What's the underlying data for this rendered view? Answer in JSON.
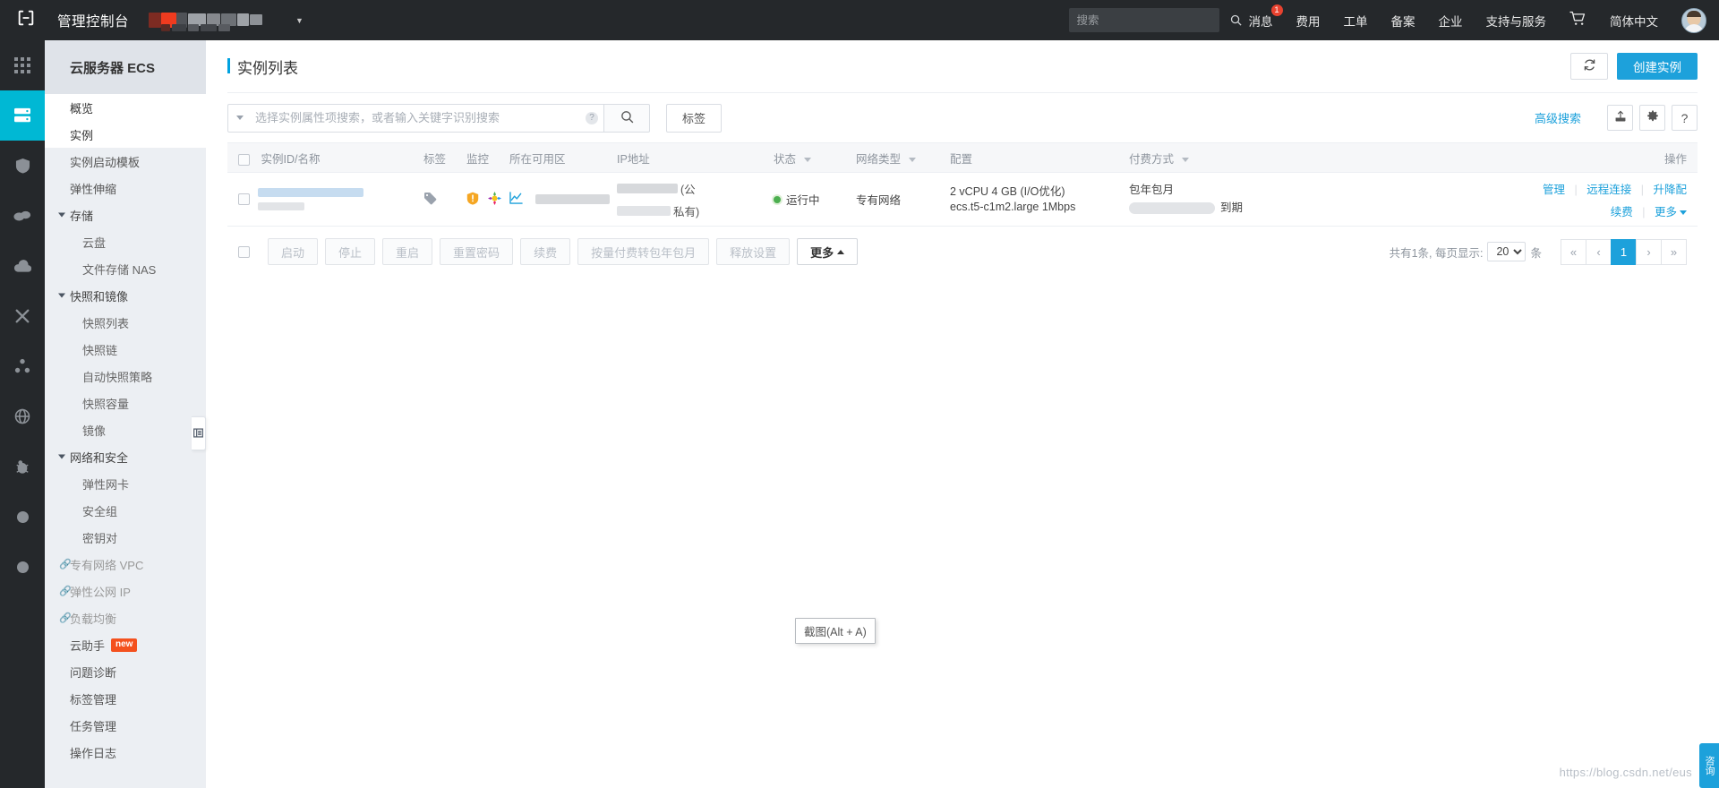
{
  "header": {
    "logo_icon": "cloud-console-logo-icon",
    "console_title": "管理控制台",
    "account_caret_icon": "chevron-down-icon",
    "search_placeholder": "搜索",
    "search_value": "",
    "search_icon": "search-icon",
    "nav_links": [
      {
        "label": "消息",
        "badge": "1"
      },
      {
        "label": "费用",
        "badge": ""
      },
      {
        "label": "工单",
        "badge": ""
      },
      {
        "label": "备案",
        "badge": ""
      },
      {
        "label": "企业",
        "badge": ""
      },
      {
        "label": "支持与服务",
        "badge": ""
      }
    ],
    "cart_icon": "shopping-cart-icon",
    "language": "简体中文",
    "avatar_icon": "user-avatar"
  },
  "rail": {
    "items": [
      {
        "icon": "app-grid-icon",
        "active": false
      },
      {
        "icon": "server-stack-icon",
        "active": true
      },
      {
        "icon": "shield-icon",
        "active": false
      },
      {
        "icon": "cloud-database-icon",
        "active": false
      },
      {
        "icon": "cloud-icon",
        "active": false
      },
      {
        "icon": "network-nodes-icon",
        "active": false
      },
      {
        "icon": "share-nodes-icon",
        "active": false
      },
      {
        "icon": "globe-icon",
        "active": false
      },
      {
        "icon": "bug-icon",
        "active": false
      },
      {
        "icon": "circle-icon",
        "active": false
      },
      {
        "icon": "circle-icon",
        "active": false
      }
    ]
  },
  "sidebar": {
    "product_title": "云服务器 ECS",
    "collapse_icon": "collapse-panel-icon",
    "items": [
      {
        "label": "概览",
        "type": "item",
        "active": false
      },
      {
        "label": "实例",
        "type": "item",
        "active": true
      },
      {
        "label": "实例启动模板",
        "type": "item",
        "active": false
      },
      {
        "label": "弹性伸缩",
        "type": "item",
        "active": false
      },
      {
        "label": "存储",
        "type": "group",
        "active": false
      },
      {
        "label": "云盘",
        "type": "sub",
        "active": false
      },
      {
        "label": "文件存储 NAS",
        "type": "sub",
        "active": false
      },
      {
        "label": "快照和镜像",
        "type": "group",
        "active": false
      },
      {
        "label": "快照列表",
        "type": "sub",
        "active": false
      },
      {
        "label": "快照链",
        "type": "sub",
        "active": false
      },
      {
        "label": "自动快照策略",
        "type": "sub",
        "active": false
      },
      {
        "label": "快照容量",
        "type": "sub",
        "active": false
      },
      {
        "label": "镜像",
        "type": "sub",
        "active": false
      },
      {
        "label": "网络和安全",
        "type": "group",
        "active": false
      },
      {
        "label": "弹性网卡",
        "type": "sub",
        "active": false
      },
      {
        "label": "安全组",
        "type": "sub",
        "active": false
      },
      {
        "label": "密钥对",
        "type": "sub",
        "active": false
      },
      {
        "label": "专有网络 VPC",
        "type": "ext",
        "active": false
      },
      {
        "label": "弹性公网 IP",
        "type": "ext",
        "active": false
      },
      {
        "label": "负载均衡",
        "type": "ext",
        "active": false
      },
      {
        "label": "云助手",
        "type": "item",
        "active": false,
        "tag": "new"
      },
      {
        "label": "问题诊断",
        "type": "item",
        "active": false
      },
      {
        "label": "标签管理",
        "type": "item",
        "active": false
      },
      {
        "label": "任务管理",
        "type": "item",
        "active": false
      },
      {
        "label": "操作日志",
        "type": "item",
        "active": false
      }
    ]
  },
  "main": {
    "page_title": "实例列表",
    "refresh_icon": "refresh-icon",
    "create_button": "创建实例",
    "filter": {
      "dropdown_caret_icon": "caret-down-icon",
      "search_placeholder": "选择实例属性项搜索，或者输入关键字识别搜索",
      "search_value": "",
      "help_icon": "question-mark-icon",
      "search_icon": "search-icon",
      "tag_button": "标签",
      "advanced_search": "高级搜索",
      "export_icon": "export-icon",
      "settings_icon": "gear-icon",
      "help_button_icon": "help-question-icon"
    },
    "table": {
      "columns": [
        {
          "label": "实例ID/名称",
          "sortable": false
        },
        {
          "label": "标签",
          "sortable": false
        },
        {
          "label": "监控",
          "sortable": false
        },
        {
          "label": "所在可用区",
          "sortable": false
        },
        {
          "label": "IP地址",
          "sortable": false
        },
        {
          "label": "状态",
          "sortable": true
        },
        {
          "label": "网络类型",
          "sortable": true
        },
        {
          "label": "配置",
          "sortable": false
        },
        {
          "label": "付费方式",
          "sortable": true
        },
        {
          "label": "操作",
          "sortable": false
        }
      ],
      "rows": [
        {
          "instance_id": "",
          "instance_name": "",
          "tag_icon": "tag-icon",
          "monitor_icons": [
            "shield-alert-icon",
            "security-colorful-icon"
          ],
          "chart_icon": "line-chart-icon",
          "zone": "",
          "ip_public": "",
          "ip_public_label": "(公",
          "ip_private": "",
          "ip_private_label": "私有)",
          "status": "运行中",
          "network_type": "专有网络",
          "config_line1": "2 vCPU 4 GB (I/O优化)",
          "config_line2": "ecs.t5-c1m2.large   1Mbps",
          "payment_type": "包年包月",
          "expire_label": "到期",
          "actions_row1": [
            "管理",
            "远程连接",
            "升降配"
          ],
          "actions_row2": [
            "续费",
            "更多"
          ]
        }
      ]
    },
    "actionbar": {
      "buttons": [
        {
          "label": "启动",
          "enabled": false
        },
        {
          "label": "停止",
          "enabled": false
        },
        {
          "label": "重启",
          "enabled": false
        },
        {
          "label": "重置密码",
          "enabled": false
        },
        {
          "label": "续费",
          "enabled": false
        },
        {
          "label": "按量付费转包年包月",
          "enabled": false
        },
        {
          "label": "释放设置",
          "enabled": false
        },
        {
          "label": "更多",
          "enabled": true
        }
      ]
    },
    "pagination": {
      "total_text_prefix": "共有1条, 每页显示:",
      "page_size": "20",
      "unit": "条",
      "first_icon": "«",
      "prev_icon": "‹",
      "current_page": "1",
      "next_icon": "›",
      "last_icon": "»"
    }
  },
  "overlay": {
    "tooltip": "截图(Alt + A)",
    "edge_widget": "咨询",
    "watermark": "https://blog.csdn.net/eus"
  }
}
